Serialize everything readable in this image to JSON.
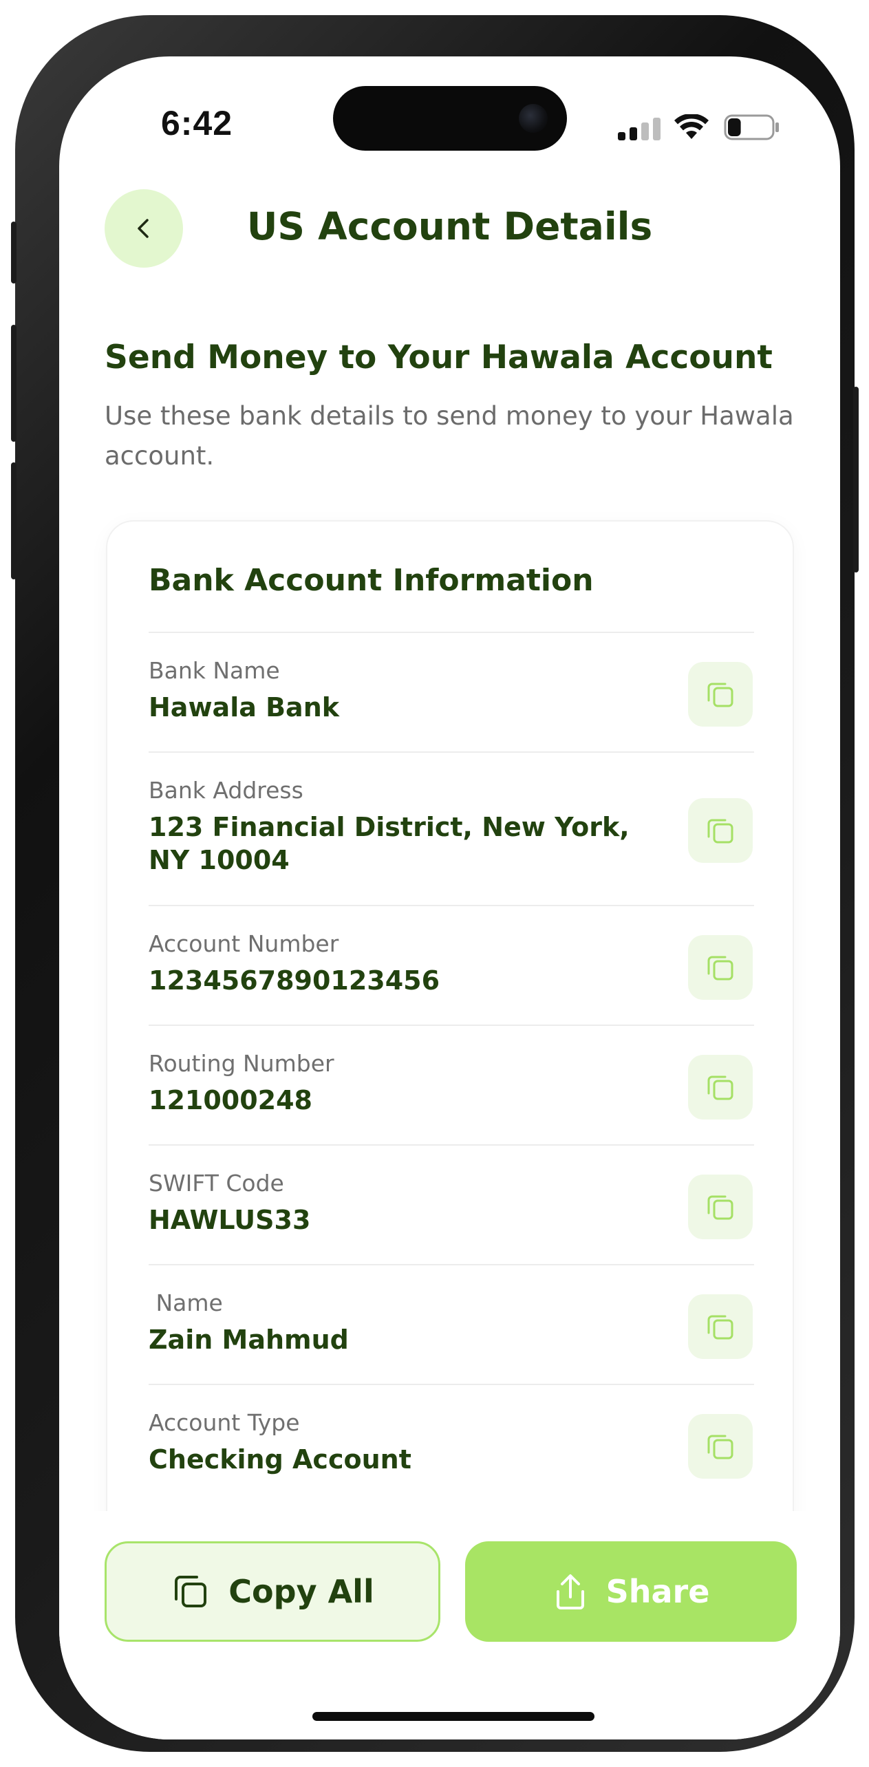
{
  "status_bar": {
    "time": "6:42",
    "signal_bars_active": 2,
    "signal_bars_total": 4,
    "battery_level_fraction": 0.3
  },
  "header": {
    "back_icon": "chevron-left-icon",
    "title": "US Account Details"
  },
  "intro": {
    "title": "Send Money to Your Hawala Account",
    "subtitle": "Use these bank details to send money to your Hawala account."
  },
  "card": {
    "title": "Bank Account Information",
    "fields": [
      {
        "label": "Bank Name",
        "value": "Hawala Bank"
      },
      {
        "label": "Bank Address",
        "value": "123 Financial District, New York, NY 10004"
      },
      {
        "label": "Account Number",
        "value": "1234567890123456"
      },
      {
        "label": "Routing Number",
        "value": "121000248"
      },
      {
        "label": "SWIFT Code",
        "value": "HAWLUS33"
      },
      {
        "label": " Name",
        "value": "Zain Mahmud"
      },
      {
        "label": "Account Type",
        "value": "Checking Account"
      }
    ],
    "copy_icon": "copy-icon"
  },
  "actions": {
    "copy_all_label": "Copy All",
    "share_label": "Share"
  },
  "colors": {
    "brand_dark_green": "#22420f",
    "accent_green": "#a8e464",
    "light_green_bg": "#e3f7cf",
    "copy_button_bg": "#eff8e6",
    "label_gray": "#6f6f6f"
  }
}
